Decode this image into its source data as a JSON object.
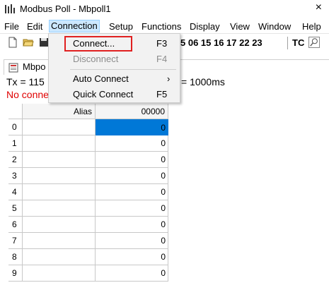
{
  "window": {
    "title": "Modbus Poll - Mbpoll1",
    "close_glyph": "×"
  },
  "menubar": [
    {
      "label": "File"
    },
    {
      "label": "Edit"
    },
    {
      "label": "Connection"
    },
    {
      "label": "Setup"
    },
    {
      "label": "Functions"
    },
    {
      "label": "Display"
    },
    {
      "label": "View"
    },
    {
      "label": "Window"
    },
    {
      "label": "Help"
    }
  ],
  "toolbar": {
    "function_codes": "5 06 15 16 17 22 23",
    "tc_label": "TC"
  },
  "child": {
    "title": "Mbpo",
    "tx_text": "Tx = 115",
    "status_text": "No conne",
    "scan_rate_text": "= 1000ms"
  },
  "grid": {
    "headers": {
      "alias": "Alias",
      "value": "00000"
    },
    "rows": [
      {
        "num": "0",
        "value": "0"
      },
      {
        "num": "1",
        "value": "0"
      },
      {
        "num": "2",
        "value": "0"
      },
      {
        "num": "3",
        "value": "0"
      },
      {
        "num": "4",
        "value": "0"
      },
      {
        "num": "5",
        "value": "0"
      },
      {
        "num": "6",
        "value": "0"
      },
      {
        "num": "7",
        "value": "0"
      },
      {
        "num": "8",
        "value": "0"
      },
      {
        "num": "9",
        "value": "0"
      }
    ]
  },
  "connection_menu": {
    "items": [
      {
        "label": "Connect...",
        "shortcut": "F3",
        "enabled": true
      },
      {
        "label": "Disconnect",
        "shortcut": "F4",
        "enabled": false
      },
      {
        "label": "Auto Connect",
        "shortcut": "",
        "submenu_glyph": "›"
      },
      {
        "label": "Quick Connect",
        "shortcut": "F5",
        "enabled": true
      }
    ]
  },
  "colors": {
    "selection": "#0078d7",
    "highlight_box": "#e02020",
    "status_text": "#e00000"
  }
}
